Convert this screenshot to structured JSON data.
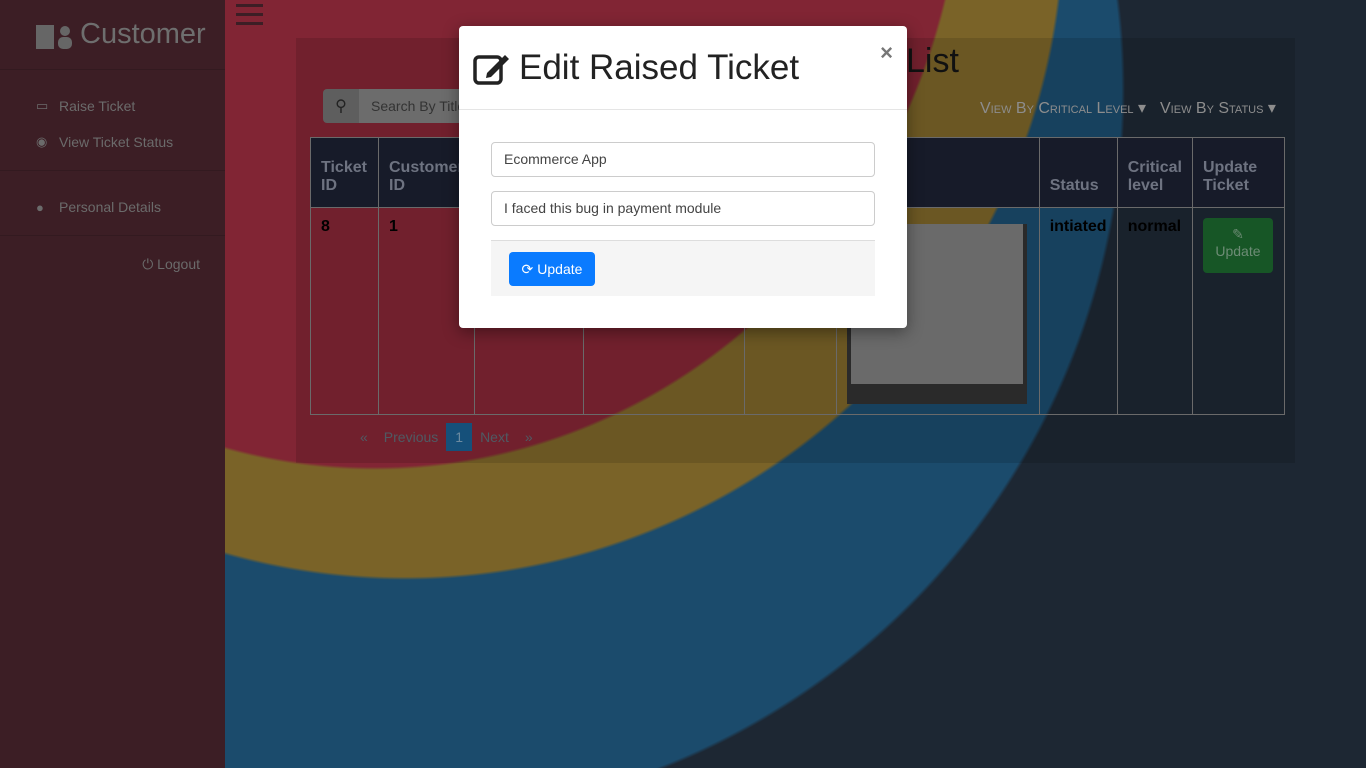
{
  "sidebar": {
    "brand": "Customer",
    "items": [
      {
        "label": "Raise Ticket"
      },
      {
        "label": "View Ticket Status"
      },
      {
        "label": "Personal Details"
      }
    ],
    "logout": "Logout"
  },
  "main": {
    "title_visible": "List",
    "search_placeholder": "Search By Title",
    "filters": [
      "View By Critical Level",
      "View By Status"
    ],
    "table": {
      "headers": [
        "Ticket ID",
        "Customer ID",
        "",
        "",
        "",
        "",
        "Status",
        "Critical level",
        "Update Ticket"
      ],
      "rows": [
        {
          "ticket_id": "8",
          "customer_id": "1",
          "status": "intiated",
          "critical_level": "normal",
          "action": "Update"
        }
      ]
    },
    "pagination": {
      "prev": "Previous",
      "page": "1",
      "next": "Next",
      "first": "«",
      "last": "»"
    }
  },
  "modal": {
    "title": "Edit Raised Ticket",
    "close": "×",
    "title_value": "Ecommerce App",
    "description_value": "I faced this bug in payment module",
    "update_label": "Update"
  }
}
